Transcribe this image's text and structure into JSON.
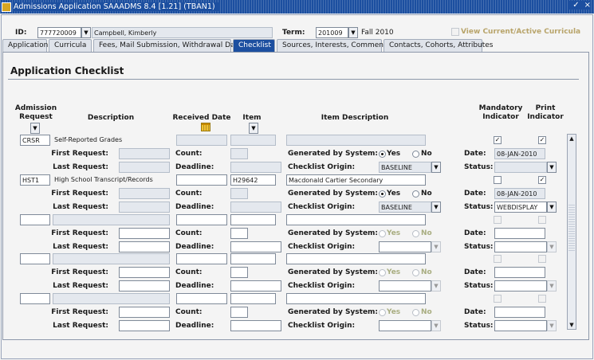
{
  "window": {
    "title": "Admissions Application  SAAADMS  8.4  [1.21]  (TBAN1)",
    "controls": [
      "✓",
      "×"
    ]
  },
  "key_block": {
    "id_label": "ID:",
    "id_value": "777720009",
    "name_value": "Campbell, Kimberly",
    "term_label": "Term:",
    "term_value": "201009",
    "term_desc": "Fall 2010",
    "view_curricula_label": "View Current/Active Curricula"
  },
  "tabs": [
    {
      "label": "Application"
    },
    {
      "label": "Curricula"
    },
    {
      "label": "Fees, Mail Submission, Withdrawal Data"
    },
    {
      "label": "Checklist"
    },
    {
      "label": "Sources, Interests, Comments"
    },
    {
      "label": "Contacts, Cohorts, Attributes"
    }
  ],
  "section": {
    "title": "Application Checklist",
    "headers": {
      "admission_request": "Admission\nRequest",
      "description": "Description",
      "received_date": "Received Date",
      "item": "Item",
      "item_description": "Item Description",
      "mandatory_indicator": "Mandatory\nIndicator",
      "print_indicator": "Print\nIndicator"
    },
    "labels": {
      "first_request": "First Request:",
      "last_request": "Last Request:",
      "count": "Count:",
      "deadline": "Deadline:",
      "generated_by_system": "Generated by System:",
      "yes": "Yes",
      "no": "No",
      "checklist_origin": "Checklist Origin:",
      "date": "Date:",
      "status": "Status:"
    }
  },
  "records": [
    {
      "admission_request": "CRSR",
      "description": "Self-Reported Grades",
      "received_date": "",
      "item": "",
      "item_description": "",
      "mandatory": true,
      "print": true,
      "generated_by_system": "yes",
      "checklist_origin": "BASELINE",
      "date": "08-JAN-2010",
      "status": ""
    },
    {
      "admission_request": "HST1",
      "description": "High School Transcript/Records",
      "received_date": "",
      "item": "H29642",
      "item_description": "Macdonald Cartier Secondary",
      "mandatory": false,
      "print": true,
      "generated_by_system": "yes",
      "checklist_origin": "BASELINE",
      "date": "08-JAN-2010",
      "status": "WEBDISPLAY"
    },
    {
      "admission_request": "",
      "description": "",
      "received_date": "",
      "item": "",
      "item_description": "",
      "mandatory": false,
      "print": false,
      "generated_by_system": "",
      "checklist_origin": "",
      "date": "",
      "status": ""
    },
    {
      "admission_request": "",
      "description": "",
      "received_date": "",
      "item": "",
      "item_description": "",
      "mandatory": false,
      "print": false,
      "generated_by_system": "",
      "checklist_origin": "",
      "date": "",
      "status": ""
    },
    {
      "admission_request": "",
      "description": "",
      "received_date": "",
      "item": "",
      "item_description": "",
      "mandatory": false,
      "print": false,
      "generated_by_system": "",
      "checklist_origin": "",
      "date": "",
      "status": ""
    }
  ],
  "icons": {
    "dropdown": "▼",
    "check": "✓",
    "scroll_up": "▲",
    "scroll_down": "▼"
  }
}
